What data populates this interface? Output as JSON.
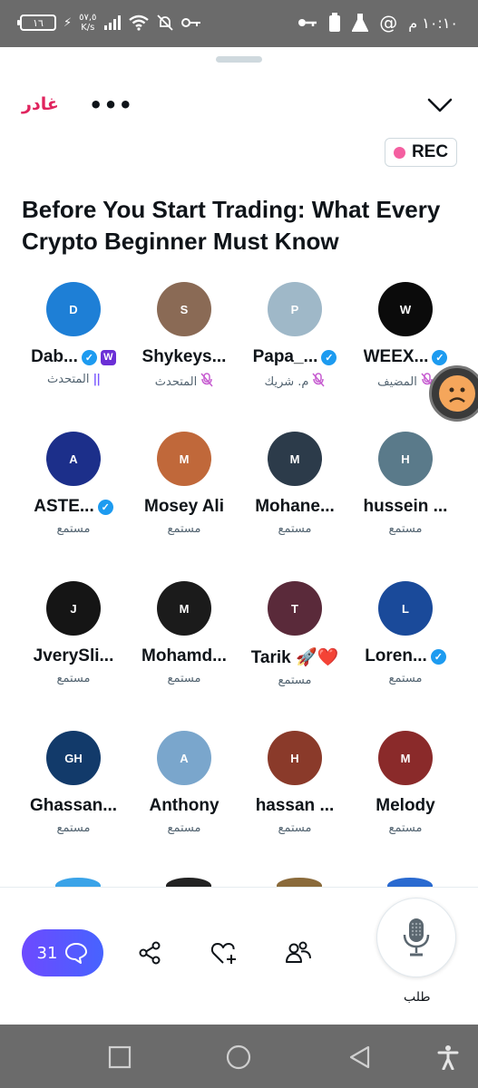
{
  "status_bar": {
    "time": "١٠:١٠ م",
    "battery": "١٦",
    "net_speed_value": "٥٧,٥",
    "net_speed_unit": "K/s"
  },
  "header": {
    "leave_label": "غادر",
    "more_label": "•••",
    "rec_label": "REC"
  },
  "space": {
    "title": "Before You Start Trading: What Every Crypto Beginner Must Know"
  },
  "participants": [
    {
      "name": "Dab...",
      "role": "المتحدث",
      "verified": true,
      "badge": "W",
      "state": "speaking",
      "color": "#1e7fd6",
      "initials": "D"
    },
    {
      "name": "Shykeys...",
      "role": "المتحدث",
      "verified": false,
      "state": "muted",
      "color": "#8a6a55",
      "initials": "S"
    },
    {
      "name": "Papa_...",
      "role": "م. شريك",
      "verified": true,
      "state": "muted",
      "color": "#9fb8c8",
      "initials": "P"
    },
    {
      "name": "WEEX...",
      "role": "المضيف",
      "verified": true,
      "state": "muted",
      "color": "#0b0b0b",
      "initials": "W"
    },
    {
      "name": "ASTE...",
      "role": "مستمع",
      "verified": true,
      "state": "listener",
      "color": "#1c2f8a",
      "initials": "A"
    },
    {
      "name": "Mosey Ali",
      "role": "مستمع",
      "verified": false,
      "state": "listener",
      "color": "#c0683a",
      "initials": "M"
    },
    {
      "name": "Mohane...",
      "role": "مستمع",
      "verified": false,
      "state": "listener",
      "color": "#2c3b4a",
      "initials": "M"
    },
    {
      "name": "hussein ...",
      "role": "مستمع",
      "verified": false,
      "state": "listener",
      "color": "#5a7a8a",
      "initials": "H"
    },
    {
      "name": "JverySli...",
      "role": "مستمع",
      "verified": false,
      "state": "listener",
      "color": "#151515",
      "initials": "J"
    },
    {
      "name": "Mohamd...",
      "role": "مستمع",
      "verified": false,
      "state": "listener",
      "color": "#1b1b1b",
      "initials": "M"
    },
    {
      "name": "Tarik 🚀❤️",
      "role": "مستمع",
      "verified": false,
      "state": "listener",
      "color": "#5a2a3a",
      "initials": "T"
    },
    {
      "name": "Loren...",
      "role": "مستمع",
      "verified": true,
      "state": "listener",
      "color": "#1a4a9a",
      "initials": "L"
    },
    {
      "name": "Ghassan...",
      "role": "مستمع",
      "verified": false,
      "state": "listener",
      "color": "#123a6a",
      "initials": "GH"
    },
    {
      "name": "Anthony",
      "role": "مستمع",
      "verified": false,
      "state": "listener",
      "color": "#7aa6cc",
      "initials": "A"
    },
    {
      "name": "hassan ...",
      "role": "مستمع",
      "verified": false,
      "state": "listener",
      "color": "#8a3a2a",
      "initials": "H"
    },
    {
      "name": "Melody",
      "role": "مستمع",
      "verified": false,
      "state": "listener",
      "color": "#8a2a2a",
      "initials": "M"
    }
  ],
  "footer": {
    "chat_count": "31",
    "request_label": "طلب"
  },
  "colors": {
    "accent": "#1d9bf0",
    "leave": "#e0245e",
    "chat_gradient_start": "#6d4aff",
    "chat_gradient_end": "#4763ff",
    "muted_mic": "#c65bd0",
    "rec_dot": "#f45fa0"
  },
  "icons": {
    "collapse": "chevron-down-icon",
    "share": "share-icon",
    "like": "heart-plus-icon",
    "people": "people-icon",
    "mic": "microphone-icon",
    "chat": "chat-bubble-icon"
  }
}
